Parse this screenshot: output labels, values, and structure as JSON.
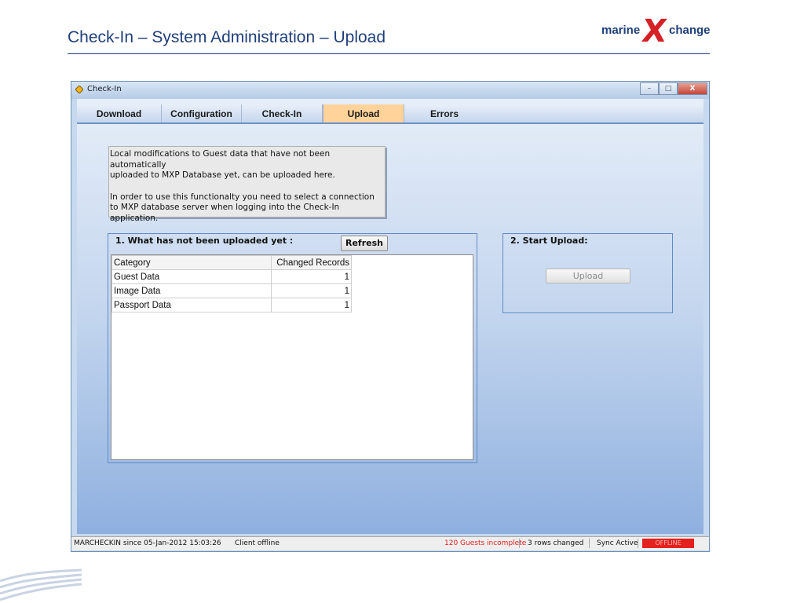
{
  "slide": {
    "title": "Check-In – System Administration – Upload",
    "logo": {
      "left": "marine",
      "middle": "X",
      "right": "change"
    }
  },
  "window": {
    "title": "Check-In",
    "controls": {
      "minimize": "–",
      "maximize": "□",
      "close": "X"
    }
  },
  "tabs": [
    {
      "label": "Download",
      "active": false
    },
    {
      "label": "Configuration",
      "active": false
    },
    {
      "label": "Check-In",
      "active": false
    },
    {
      "label": "Upload",
      "active": true
    },
    {
      "label": "Errors",
      "active": false
    }
  ],
  "info": {
    "line1": "Local modifications to Guest data that have not been automatically",
    "line2": "uploaded to MXP Database yet, can be uploaded here.",
    "line3": "In order to use this functionalty you need to select a connection",
    "line4": "to MXP database server when logging into the Check-In application."
  },
  "section1": {
    "title": "1. What has not been uploaded yet :",
    "refresh_label": "Refresh",
    "columns": [
      "Category",
      "Changed Records"
    ],
    "rows": [
      {
        "category": "Guest Data",
        "changed": "1"
      },
      {
        "category": "Image Data",
        "changed": "1"
      },
      {
        "category": "Passport Data",
        "changed": "1"
      }
    ]
  },
  "section2": {
    "title": "2. Start Upload:",
    "upload_label": "Upload"
  },
  "status": {
    "user": "MARCHECKIN since 05-Jan-2012 15:03:26",
    "client": "Client offline",
    "guests": "120 Guests incomplete",
    "rows_changed": "3 rows changed",
    "sync": "Sync Active",
    "offline": "OFFLINE"
  },
  "colors": {
    "title_blue": "#1f3f7a",
    "logo_red": "#d52027",
    "active_tab": "#ffd39a",
    "status_warning": "#e3211d"
  }
}
